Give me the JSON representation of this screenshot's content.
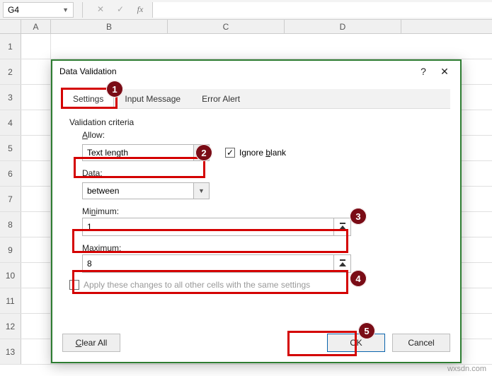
{
  "namebox": {
    "value": "G4"
  },
  "columns": [
    "A",
    "B",
    "C",
    "D"
  ],
  "rows": [
    "1",
    "2",
    "3",
    "4",
    "5",
    "6",
    "7",
    "8",
    "9",
    "10",
    "11",
    "12",
    "13"
  ],
  "dialog": {
    "title": "Data Validation",
    "help": "?",
    "close": "✕",
    "tabs": {
      "settings": "Settings",
      "input_message": "Input Message",
      "error_alert": "Error Alert"
    },
    "section": "Validation criteria",
    "allow_label": "Allow:",
    "allow_value": "Text length",
    "ignore_blank_label": "Ignore blank",
    "data_label": "Data:",
    "data_value": "between",
    "min_label": "Minimum:",
    "min_value": "1",
    "max_label": "Maximum:",
    "max_value": "8",
    "apply_label": "Apply these changes to all other cells with the same settings",
    "clear_all": "Clear All",
    "ok": "OK",
    "cancel": "Cancel"
  },
  "badges": {
    "b1": "1",
    "b2": "2",
    "b3": "3",
    "b4": "4",
    "b5": "5"
  },
  "watermark": "wxsdn.com"
}
